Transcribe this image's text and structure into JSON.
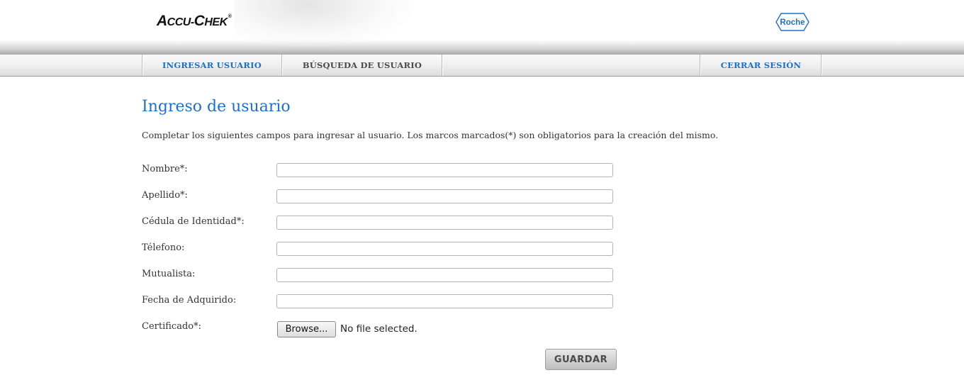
{
  "header": {
    "brand_main": "A",
    "brand_1": "CCU-",
    "brand_2": "C",
    "brand_3": "HEK",
    "brand_reg": "®",
    "partner_logo": "Roche"
  },
  "nav": {
    "items": [
      {
        "label": "INGRESAR USUARIO"
      },
      {
        "label": "BÚSQUEDA DE USUARIO"
      },
      {
        "label": "CERRAR SESIÓN"
      }
    ]
  },
  "main": {
    "title": "Ingreso de usuario",
    "description": "Completar los siguientes campos para ingresar al usuario. Los marcos marcados(*) son obligatorios para la creación del mismo.",
    "fields": [
      {
        "label": "Nombre*:",
        "value": ""
      },
      {
        "label": "Apellido*:",
        "value": ""
      },
      {
        "label": "Cédula de Identidad*:",
        "value": ""
      },
      {
        "label": "Télefono:",
        "value": ""
      },
      {
        "label": "Mutualista:",
        "value": ""
      },
      {
        "label": "Fecha de Adquirido:",
        "value": ""
      },
      {
        "label": "Certificado*:"
      }
    ],
    "browse_label": "Browse...",
    "no_file_text": "No file selected.",
    "save_label": "GUARDAR"
  },
  "colors": {
    "accent_blue": "#1f6fc5",
    "nav_gray_text": "#4a4a4a"
  }
}
